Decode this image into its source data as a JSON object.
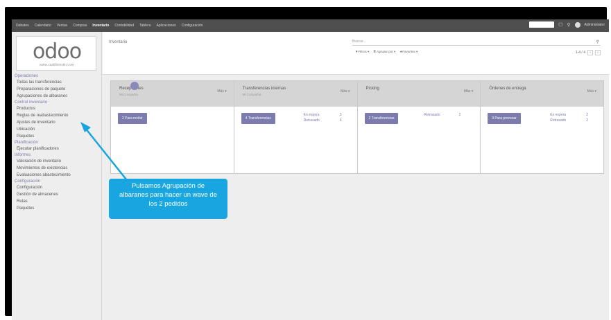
{
  "topbar": {
    "menu": [
      "Debates",
      "Calendario",
      "Ventas",
      "Compras",
      "Inventario",
      "Contabilidad",
      "Tablero",
      "Aplicaciones",
      "Configuración"
    ],
    "active_index": 4,
    "user": "Administrator"
  },
  "sidebar": {
    "logo": "odoo",
    "logo_url": "www.castilloinstin.com",
    "sections": [
      {
        "heading": "Operaciones",
        "items": [
          "Todas las transferencias",
          "Preparaciones de paquete",
          "Agrupaciones de albaranes"
        ]
      },
      {
        "heading": "Control inventario",
        "items": [
          "Productos",
          "Reglas de reabastecimiento",
          "Ajustes de inventario",
          "Ubicación",
          "Paquetes"
        ]
      },
      {
        "heading": "Planificación",
        "items": [
          "Ejecutar planificadores"
        ]
      },
      {
        "heading": "Informes",
        "items": [
          "Valoración de inventario",
          "Movimientos de existencias",
          "Evaluaciones abastecimiento"
        ]
      },
      {
        "heading": "Configuración",
        "items": [
          "Configuración",
          "Gestión de almacenes",
          "Rutas",
          "Paquetes"
        ]
      }
    ]
  },
  "control": {
    "breadcrumb": "Inventario",
    "search_placeholder": "Buscar...",
    "filters": [
      "▼Filtros ▾",
      "≣ Agrupar por ▾",
      "★Favoritos ▾"
    ],
    "pager": "1-4 / 4"
  },
  "cards": [
    {
      "title": "Recepciones",
      "sub": "Mi Compañía",
      "more": "Más ▾",
      "button": "2 Para recibir",
      "stats": []
    },
    {
      "title": "Transferencias internas",
      "sub": "Mi Compañía",
      "more": "Más ▾",
      "button": "4 Transferencias",
      "stats": [
        {
          "label": "En espera",
          "value": "3"
        },
        {
          "label": "Retrasado",
          "value": "4"
        }
      ]
    },
    {
      "title": "Picking",
      "sub": "",
      "more": "Más ▾",
      "button": "2 Transferencias",
      "stats": [
        {
          "label": "Retrasado",
          "value": "2"
        }
      ]
    },
    {
      "title": "Órdenes de entrega",
      "sub": "",
      "more": "Más ▾",
      "button": "3 Para procesar",
      "stats": [
        {
          "label": "En espera",
          "value": "2"
        },
        {
          "label": "Retrasado",
          "value": "2"
        }
      ]
    }
  ],
  "callout": {
    "text": "Pulsamos Agrupación de albaranes para hacer un wave de los 2 pedidos"
  },
  "colors": {
    "accent": "#7c7bad",
    "callout": "#19a5df",
    "topbar": "#4f4f4f"
  }
}
